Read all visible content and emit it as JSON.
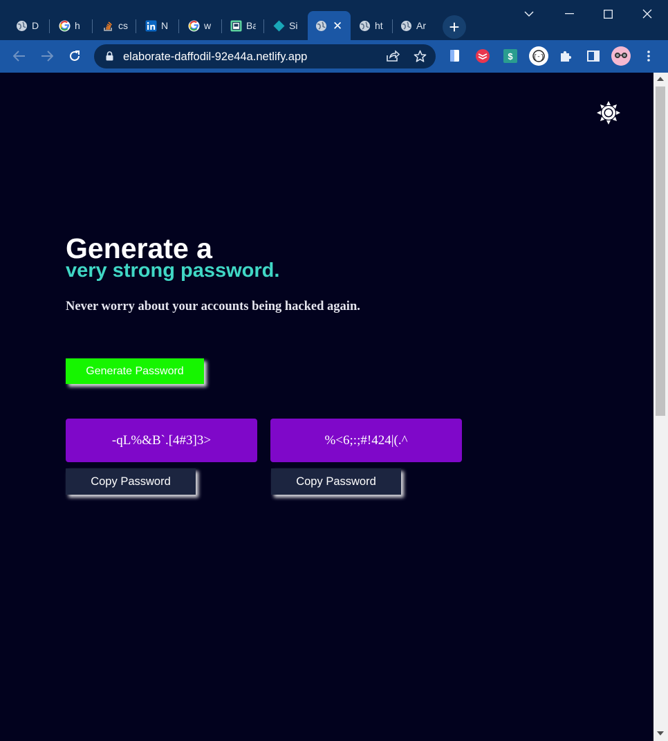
{
  "browser": {
    "tabs": [
      {
        "title": "D",
        "icon": "globe-icon"
      },
      {
        "title": "h",
        "icon": "google-icon"
      },
      {
        "title": "cs",
        "icon": "stackoverflow-icon"
      },
      {
        "title": "N",
        "icon": "linkedin-icon"
      },
      {
        "title": "w",
        "icon": "google-icon"
      },
      {
        "title": "Ba",
        "icon": "app-icon"
      },
      {
        "title": "Si",
        "icon": "diamond-icon"
      },
      {
        "title": "",
        "icon": "globe-icon",
        "active": true
      },
      {
        "title": "ht",
        "icon": "globe-icon"
      },
      {
        "title": "Ar",
        "icon": "globe-icon"
      }
    ],
    "new_tab_label": "+",
    "url": "elaborate-daffodil-92e44a.netlify.app",
    "colors": {
      "tabstrip": "#0a2a52",
      "toolbar": "#1b57a5"
    }
  },
  "page": {
    "headline": "Generate a",
    "headline_accent": "very strong password.",
    "subtitle": "Never worry about your accounts being hacked again.",
    "generate_label": "Generate Password",
    "passwords": [
      {
        "value": "-qL%&B`.[4#3]3>",
        "copy_label": "Copy Password"
      },
      {
        "value": "%<6;:;#!424|(.^",
        "copy_label": "Copy Password"
      }
    ],
    "theme_icon": "sun-icon",
    "colors": {
      "background": "#02021e",
      "accent": "#40d7c5",
      "generate_button": "#16f500",
      "password_box": "#7f08c9",
      "copy_button": "#1c2540"
    }
  }
}
